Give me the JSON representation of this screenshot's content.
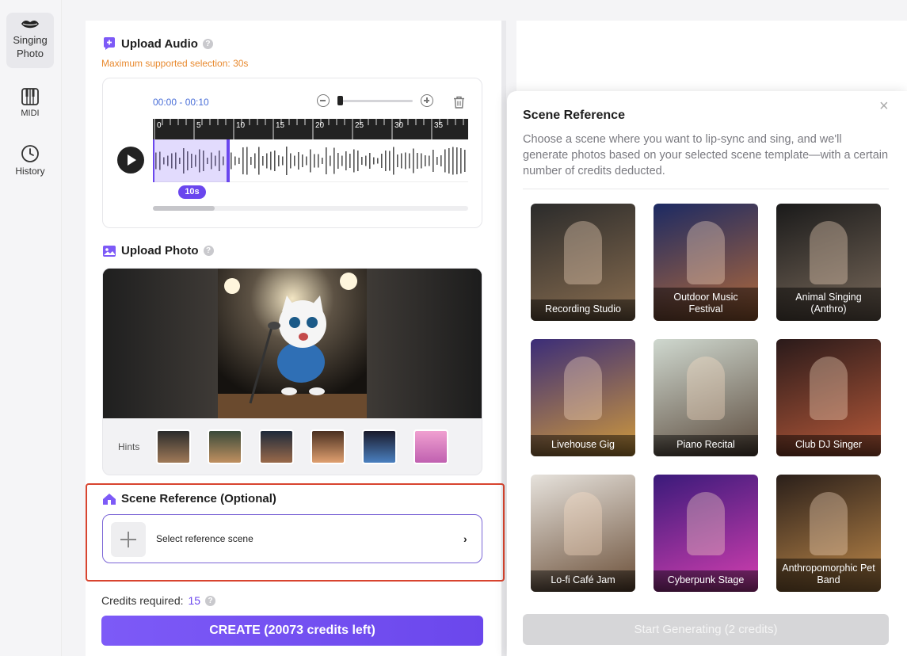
{
  "sidebar": {
    "items": [
      {
        "label": "Singing Photo",
        "icon": "lips-icon"
      },
      {
        "label": "MIDI",
        "icon": "piano-icon"
      },
      {
        "label": "History",
        "icon": "clock-icon"
      }
    ]
  },
  "upload_audio": {
    "title": "Upload Audio",
    "max_note": "Maximum supported selection: 30s",
    "time_range": "00:00 - 00:10",
    "ruler_ticks": [
      "0",
      "5",
      "10",
      "15",
      "20",
      "25",
      "30",
      "35"
    ],
    "selection_duration": "10s",
    "selection_fraction": 0.25
  },
  "upload_photo": {
    "title": "Upload Photo",
    "hints_label": "Hints"
  },
  "scene_reference": {
    "title": "Scene Reference (Optional)",
    "select_label": "Select reference scene"
  },
  "credits": {
    "label": "Credits required:",
    "value": "15"
  },
  "create_button": "CREATE (20073 credits left)",
  "popup": {
    "title": "Scene Reference",
    "description": "Choose a scene where you want to lip-sync and sing, and we'll generate photos based on your selected scene template—with a certain number of credits deducted.",
    "close": "×",
    "scenes": [
      {
        "label": "Recording Studio",
        "color1": "#2b2b2b",
        "color2": "#8a6e50"
      },
      {
        "label": "Outdoor Music Festival",
        "color1": "#1c2a63",
        "color2": "#b36a3a"
      },
      {
        "label": "Animal Singing (Anthro)",
        "color1": "#1a1a1a",
        "color2": "#7b6b5c"
      },
      {
        "label": "Livehouse Gig",
        "color1": "#3b2d78",
        "color2": "#d09a3c"
      },
      {
        "label": "Piano Recital",
        "color1": "#cfd8cf",
        "color2": "#5b4a3c"
      },
      {
        "label": "Club DJ Singer",
        "color1": "#2a1a1a",
        "color2": "#b85a3a"
      },
      {
        "label": "Lo-fi Café Jam",
        "color1": "#e6e2dc",
        "color2": "#6b4f38"
      },
      {
        "label": "Cyberpunk Stage",
        "color1": "#3a1a7a",
        "color2": "#d43fb0"
      },
      {
        "label": "Anthropomorphic Pet Band",
        "color1": "#2a1f1a",
        "color2": "#c08a4a"
      }
    ],
    "start_button": "Start Generating (2 credits)"
  },
  "colors": {
    "accent": "#6b47ec",
    "warning": "#e8892e",
    "highlight_outline": "#d8442f"
  }
}
